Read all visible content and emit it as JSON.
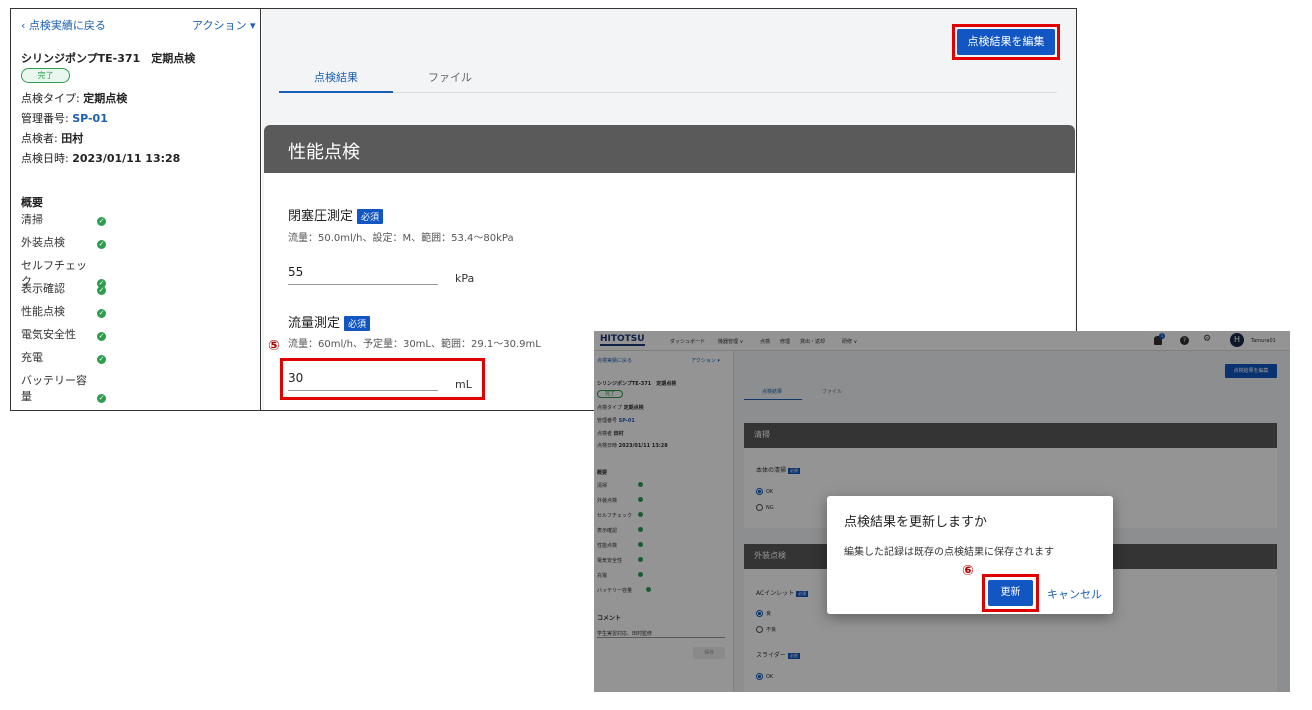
{
  "shot1": {
    "sidebar": {
      "back_link": "点検実績に戻る",
      "actions": "アクション",
      "title": "シリンジポンプTE-371　定期点検",
      "status_badge": "完了",
      "type_label": "点検タイプ: ",
      "type_value": "定期点検",
      "mgmt_label": "管理番号: ",
      "mgmt_value": "SP-01",
      "inspector_label": "点検者: ",
      "inspector_value": "田村",
      "date_label": "点検日時: ",
      "date_value": "2023/01/11 13:28",
      "summary_heading": "概要",
      "summary_items": [
        "清掃",
        "外装点検",
        "セルフチェック",
        "表示確認",
        "性能点検",
        "電気安全性",
        "充電",
        "バッテリー容量"
      ]
    },
    "main": {
      "edit_button": "点検結果を編集",
      "tabs": [
        "点検結果",
        "ファイル"
      ],
      "section_title": "性能点検",
      "required_badge": "必須",
      "fields": [
        {
          "title": "閉塞圧測定",
          "desc": "流量：50.0ml/h、設定：M、範囲：53.4〜80kPa",
          "value": "55",
          "unit": "kPa"
        },
        {
          "title": "流量測定",
          "desc": "流量：60ml/h、予定量：30mL、範囲：29.1〜30.9mL",
          "value": "30",
          "unit": "mL"
        }
      ],
      "step_marker": "⑤"
    }
  },
  "shot2": {
    "topbar": {
      "logo": "HITOTSU",
      "nav": [
        "ダッシュボード",
        "機器管理 ∨",
        "点検",
        "修理",
        "貸出・返却",
        "研修 ∨"
      ],
      "notif_count": "1",
      "avatar_initial": "H",
      "username": "Tamura01"
    },
    "sidebar": {
      "back_link": "点検実績に戻る",
      "actions": "アクション ▾",
      "title": "シリンジポンプTE-371　定期点検",
      "status_badge": "完了",
      "type_label": "点検タイプ",
      "type_value": "定期点検",
      "mgmt_label": "管理番号",
      "mgmt_value": "SP-01",
      "inspector_label": "点検者",
      "inspector_value": "田村",
      "date_label": "点検日時",
      "date_value": "2023/01/11 13:28",
      "summary_heading": "概要",
      "summary_items": [
        "清掃",
        "外装点検",
        "セルフチェック",
        "表示確認",
        "性能点検",
        "電気安全性",
        "充電",
        "バッテリー容量"
      ],
      "comment_heading": "コメント",
      "comment_value": "学生実習対応、田村監修",
      "save_button": "保存"
    },
    "main": {
      "edit_button": "点検結果を編集",
      "tabs": [
        "点検結果",
        "ファイル"
      ],
      "required_badge": "必須",
      "sections": [
        {
          "title": "清掃",
          "field": "本体の清掃",
          "options": [
            "OK",
            "NG"
          ]
        },
        {
          "title": "外装点検",
          "field": "ACインレット",
          "options": [
            "良",
            "不良"
          ],
          "field2": "スライダー",
          "options2": [
            "OK"
          ]
        }
      ]
    },
    "dialog": {
      "title": "点検結果を更新しますか",
      "message": "編集した記録は既存の点検結果に保存されます",
      "confirm_button": "更新",
      "cancel_button": "キャンセル",
      "step_marker": "⑥"
    }
  }
}
